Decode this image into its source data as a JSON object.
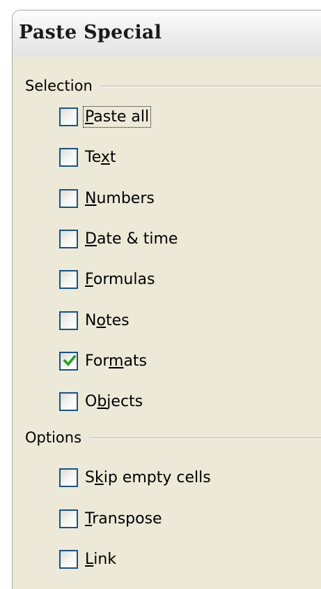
{
  "dialog": {
    "title": "Paste Special"
  },
  "selection": {
    "label": "Selection",
    "items": [
      {
        "pre": "",
        "key": "P",
        "post": "aste all",
        "checked": false,
        "focused": true
      },
      {
        "pre": "Te",
        "key": "x",
        "post": "t",
        "checked": false,
        "focused": false
      },
      {
        "pre": "",
        "key": "N",
        "post": "umbers",
        "checked": false,
        "focused": false
      },
      {
        "pre": "",
        "key": "D",
        "post": "ate & time",
        "checked": false,
        "focused": false
      },
      {
        "pre": "",
        "key": "F",
        "post": "ormulas",
        "checked": false,
        "focused": false
      },
      {
        "pre": "N",
        "key": "o",
        "post": "tes",
        "checked": false,
        "focused": false
      },
      {
        "pre": "For",
        "key": "m",
        "post": "ats",
        "checked": true,
        "focused": false
      },
      {
        "pre": "O",
        "key": "b",
        "post": "jects",
        "checked": false,
        "focused": false
      }
    ]
  },
  "options": {
    "label": "Options",
    "items": [
      {
        "pre": "S",
        "key": "k",
        "post": "ip empty cells",
        "checked": false,
        "focused": false
      },
      {
        "pre": "",
        "key": "T",
        "post": "ranspose",
        "checked": false,
        "focused": false
      },
      {
        "pre": "",
        "key": "L",
        "post": "ink",
        "checked": false,
        "focused": false
      }
    ]
  },
  "colors": {
    "check": "#21a121",
    "checkbox_border": "#1c5180",
    "dialog_bg": "#ece9d8"
  }
}
